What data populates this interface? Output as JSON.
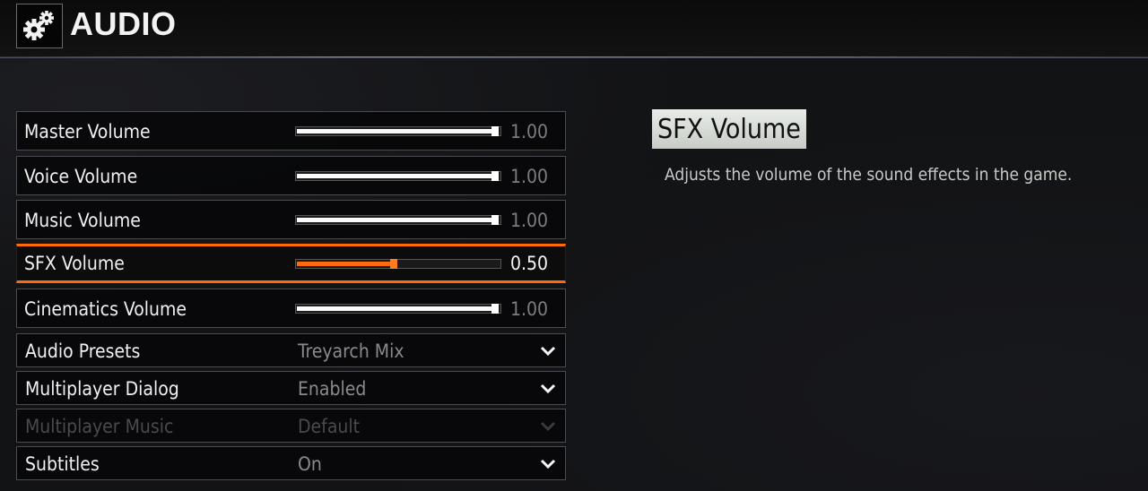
{
  "header": {
    "title": "AUDIO",
    "icon": "gears-icon"
  },
  "colors": {
    "accent": "#ff6a0a",
    "slider": "#fafafa",
    "dim_value": "#7d7d7d"
  },
  "sliders": [
    {
      "label": "Master Volume",
      "value": 1.0,
      "value_text": "1.00",
      "active": false
    },
    {
      "label": "Voice Volume",
      "value": 1.0,
      "value_text": "1.00",
      "active": false
    },
    {
      "label": "Music Volume",
      "value": 1.0,
      "value_text": "1.00",
      "active": false
    },
    {
      "label": "SFX Volume",
      "value": 0.5,
      "value_text": "0.50",
      "active": true
    },
    {
      "label": "Cinematics Volume",
      "value": 1.0,
      "value_text": "1.00",
      "active": false
    }
  ],
  "dropdowns": [
    {
      "label": "Audio Presets",
      "value": "Treyarch Mix",
      "disabled": false
    },
    {
      "label": "Multiplayer Dialog",
      "value": "Enabled",
      "disabled": false
    },
    {
      "label": "Multiplayer Music",
      "value": "Default",
      "disabled": true
    },
    {
      "label": "Subtitles",
      "value": "On",
      "disabled": false
    }
  ],
  "detail": {
    "title": "SFX Volume",
    "description": "Adjusts the volume of the sound effects in the game."
  }
}
